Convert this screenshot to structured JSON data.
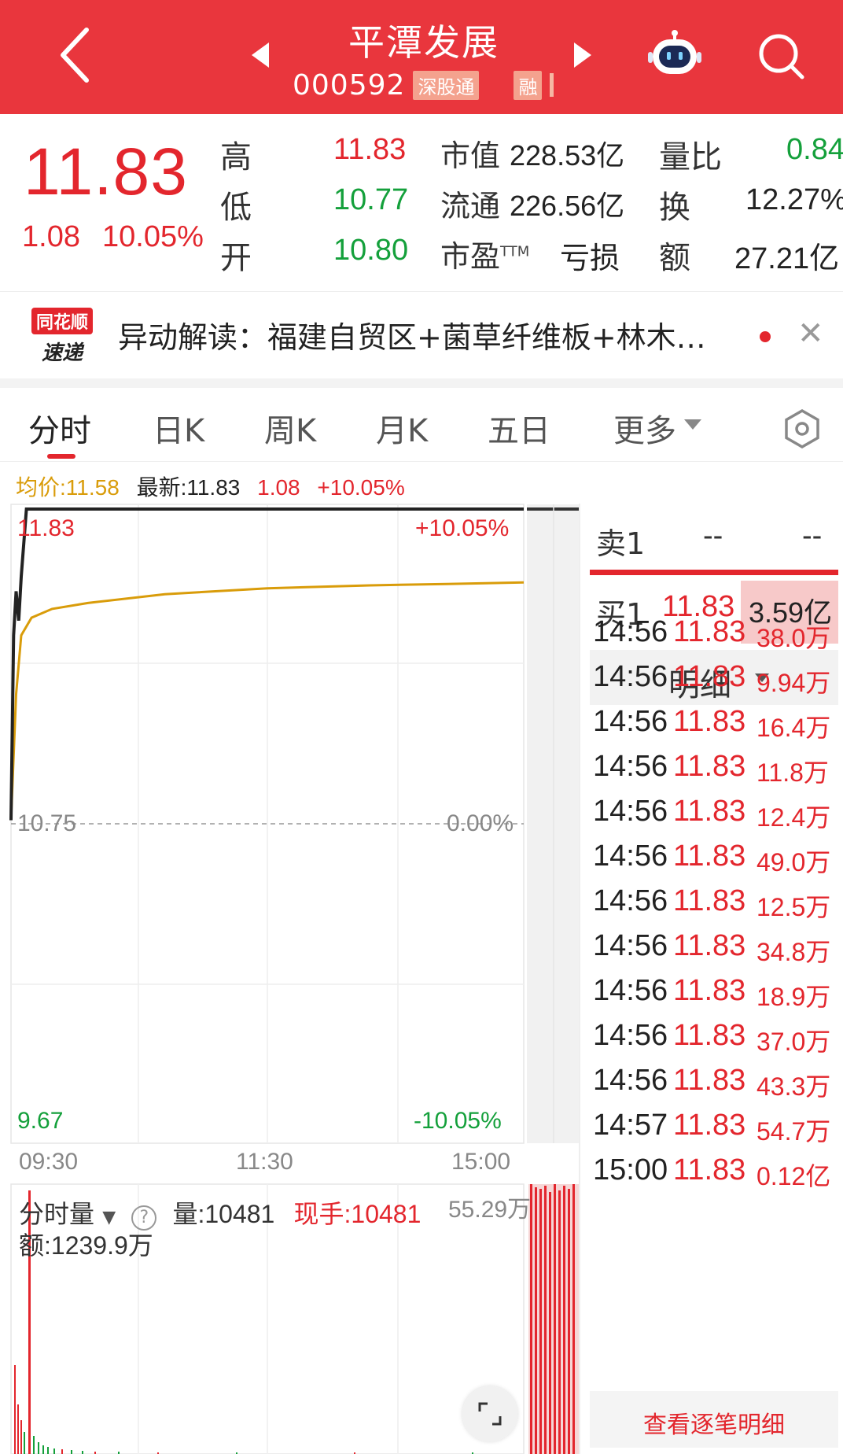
{
  "header": {
    "title": "平潭发展",
    "code": "000592",
    "badge_connect": "深股通",
    "badge_margin": "融"
  },
  "quote": {
    "price": "11.83",
    "change": "1.08",
    "change_pct": "10.05%",
    "high_label": "高",
    "high": "11.83",
    "low_label": "低",
    "low": "10.77",
    "open_label": "开",
    "open": "10.80",
    "mktcap_label": "市值",
    "mktcap": "228.53亿",
    "float_label": "流通",
    "float": "226.56亿",
    "pe_label": "市盈",
    "pe_sup": "TTM",
    "pe": "亏损",
    "volratio_label": "量比",
    "volratio": "0.84",
    "turnover_label": "换",
    "turnover": "12.27%",
    "amount_label": "额",
    "amount": "27.21亿"
  },
  "news": {
    "logo_top": "同花顺",
    "logo_bottom": "速递",
    "text": "异动解读：福建自贸区+菌草纤维板+林木…"
  },
  "tabs": [
    "分时",
    "日K",
    "周K",
    "月K",
    "五日",
    "更多"
  ],
  "info": {
    "avg": "均价:11.58",
    "latest": "最新:11.83",
    "change": "1.08",
    "change_pct": "+10.05%"
  },
  "chart_labels": {
    "top_price": "11.83",
    "top_pct": "+10.05%",
    "mid_price": "10.75",
    "mid_pct": "0.00%",
    "bottom_price": "9.67",
    "bottom_pct": "-10.05%",
    "time_start": "09:30",
    "time_mid": "11:30",
    "time_end": "15:00"
  },
  "chart_data": {
    "type": "line",
    "ylim": [
      9.67,
      11.83
    ],
    "series": [
      {
        "name": "均价",
        "color": "#d99c0a",
        "x": [
          0,
          0.01,
          0.02,
          0.04,
          0.08,
          0.15,
          0.3,
          0.5,
          0.7,
          0.85,
          1.0
        ],
        "values": [
          10.77,
          11.2,
          11.4,
          11.46,
          11.49,
          11.51,
          11.54,
          11.56,
          11.57,
          11.575,
          11.58
        ]
      },
      {
        "name": "最新",
        "color": "#222222",
        "x": [
          0,
          0.005,
          0.01,
          0.015,
          0.02,
          0.03,
          0.04,
          1.0
        ],
        "values": [
          10.77,
          11.4,
          11.55,
          11.45,
          11.6,
          11.83,
          11.83,
          11.83
        ]
      }
    ]
  },
  "volume": {
    "label": "分时量",
    "vol": "量:10481",
    "hand": "现手:10481",
    "max": "55.29万",
    "amount": "额:1239.9万"
  },
  "order_book": {
    "ask_label": "卖1",
    "ask_price": "--",
    "ask_vol": "--",
    "bid_label": "买1",
    "bid_price": "11.83",
    "bid_vol": "3.59亿",
    "detail_label": "明细"
  },
  "trades": [
    {
      "time": "14:56",
      "price": "11.83",
      "vol": "38.0万"
    },
    {
      "time": "14:56",
      "price": "11.83",
      "vol": "9.94万"
    },
    {
      "time": "14:56",
      "price": "11.83",
      "vol": "16.4万"
    },
    {
      "time": "14:56",
      "price": "11.83",
      "vol": "11.8万"
    },
    {
      "time": "14:56",
      "price": "11.83",
      "vol": "12.4万"
    },
    {
      "time": "14:56",
      "price": "11.83",
      "vol": "49.0万"
    },
    {
      "time": "14:56",
      "price": "11.83",
      "vol": "12.5万"
    },
    {
      "time": "14:56",
      "price": "11.83",
      "vol": "34.8万"
    },
    {
      "time": "14:56",
      "price": "11.83",
      "vol": "18.9万"
    },
    {
      "time": "14:56",
      "price": "11.83",
      "vol": "37.0万"
    },
    {
      "time": "14:56",
      "price": "11.83",
      "vol": "43.3万"
    },
    {
      "time": "14:57",
      "price": "11.83",
      "vol": "54.7万"
    },
    {
      "time": "15:00",
      "price": "11.83",
      "vol": "0.12亿"
    }
  ],
  "tick_link": "查看逐笔明细",
  "colors": {
    "brand": "#e9363d",
    "up": "#e3262d",
    "down": "#14a03b",
    "avg": "#d99c0a"
  }
}
